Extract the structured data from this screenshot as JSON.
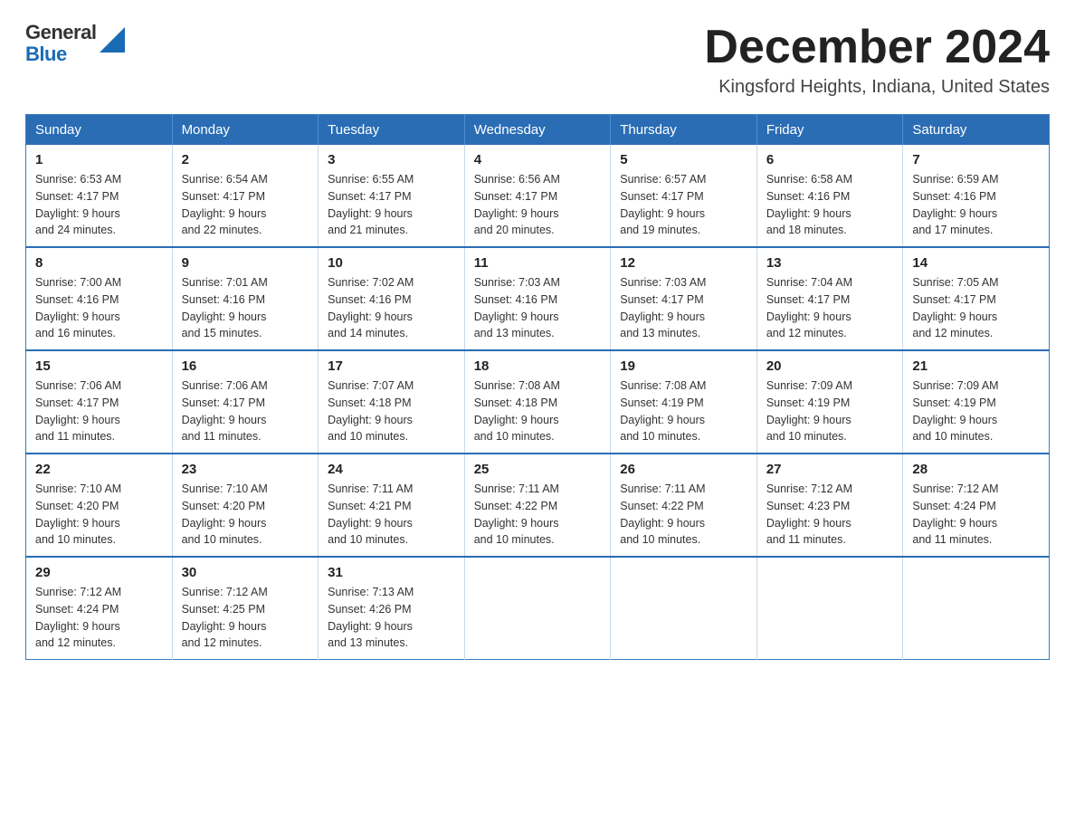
{
  "header": {
    "logo_general": "General",
    "logo_blue": "Blue",
    "month_title": "December 2024",
    "location": "Kingsford Heights, Indiana, United States"
  },
  "days_of_week": [
    "Sunday",
    "Monday",
    "Tuesday",
    "Wednesday",
    "Thursday",
    "Friday",
    "Saturday"
  ],
  "weeks": [
    [
      {
        "day": "1",
        "sunrise": "6:53 AM",
        "sunset": "4:17 PM",
        "daylight": "9 hours and 24 minutes."
      },
      {
        "day": "2",
        "sunrise": "6:54 AM",
        "sunset": "4:17 PM",
        "daylight": "9 hours and 22 minutes."
      },
      {
        "day": "3",
        "sunrise": "6:55 AM",
        "sunset": "4:17 PM",
        "daylight": "9 hours and 21 minutes."
      },
      {
        "day": "4",
        "sunrise": "6:56 AM",
        "sunset": "4:17 PM",
        "daylight": "9 hours and 20 minutes."
      },
      {
        "day": "5",
        "sunrise": "6:57 AM",
        "sunset": "4:17 PM",
        "daylight": "9 hours and 19 minutes."
      },
      {
        "day": "6",
        "sunrise": "6:58 AM",
        "sunset": "4:16 PM",
        "daylight": "9 hours and 18 minutes."
      },
      {
        "day": "7",
        "sunrise": "6:59 AM",
        "sunset": "4:16 PM",
        "daylight": "9 hours and 17 minutes."
      }
    ],
    [
      {
        "day": "8",
        "sunrise": "7:00 AM",
        "sunset": "4:16 PM",
        "daylight": "9 hours and 16 minutes."
      },
      {
        "day": "9",
        "sunrise": "7:01 AM",
        "sunset": "4:16 PM",
        "daylight": "9 hours and 15 minutes."
      },
      {
        "day": "10",
        "sunrise": "7:02 AM",
        "sunset": "4:16 PM",
        "daylight": "9 hours and 14 minutes."
      },
      {
        "day": "11",
        "sunrise": "7:03 AM",
        "sunset": "4:16 PM",
        "daylight": "9 hours and 13 minutes."
      },
      {
        "day": "12",
        "sunrise": "7:03 AM",
        "sunset": "4:17 PM",
        "daylight": "9 hours and 13 minutes."
      },
      {
        "day": "13",
        "sunrise": "7:04 AM",
        "sunset": "4:17 PM",
        "daylight": "9 hours and 12 minutes."
      },
      {
        "day": "14",
        "sunrise": "7:05 AM",
        "sunset": "4:17 PM",
        "daylight": "9 hours and 12 minutes."
      }
    ],
    [
      {
        "day": "15",
        "sunrise": "7:06 AM",
        "sunset": "4:17 PM",
        "daylight": "9 hours and 11 minutes."
      },
      {
        "day": "16",
        "sunrise": "7:06 AM",
        "sunset": "4:17 PM",
        "daylight": "9 hours and 11 minutes."
      },
      {
        "day": "17",
        "sunrise": "7:07 AM",
        "sunset": "4:18 PM",
        "daylight": "9 hours and 10 minutes."
      },
      {
        "day": "18",
        "sunrise": "7:08 AM",
        "sunset": "4:18 PM",
        "daylight": "9 hours and 10 minutes."
      },
      {
        "day": "19",
        "sunrise": "7:08 AM",
        "sunset": "4:19 PM",
        "daylight": "9 hours and 10 minutes."
      },
      {
        "day": "20",
        "sunrise": "7:09 AM",
        "sunset": "4:19 PM",
        "daylight": "9 hours and 10 minutes."
      },
      {
        "day": "21",
        "sunrise": "7:09 AM",
        "sunset": "4:19 PM",
        "daylight": "9 hours and 10 minutes."
      }
    ],
    [
      {
        "day": "22",
        "sunrise": "7:10 AM",
        "sunset": "4:20 PM",
        "daylight": "9 hours and 10 minutes."
      },
      {
        "day": "23",
        "sunrise": "7:10 AM",
        "sunset": "4:20 PM",
        "daylight": "9 hours and 10 minutes."
      },
      {
        "day": "24",
        "sunrise": "7:11 AM",
        "sunset": "4:21 PM",
        "daylight": "9 hours and 10 minutes."
      },
      {
        "day": "25",
        "sunrise": "7:11 AM",
        "sunset": "4:22 PM",
        "daylight": "9 hours and 10 minutes."
      },
      {
        "day": "26",
        "sunrise": "7:11 AM",
        "sunset": "4:22 PM",
        "daylight": "9 hours and 10 minutes."
      },
      {
        "day": "27",
        "sunrise": "7:12 AM",
        "sunset": "4:23 PM",
        "daylight": "9 hours and 11 minutes."
      },
      {
        "day": "28",
        "sunrise": "7:12 AM",
        "sunset": "4:24 PM",
        "daylight": "9 hours and 11 minutes."
      }
    ],
    [
      {
        "day": "29",
        "sunrise": "7:12 AM",
        "sunset": "4:24 PM",
        "daylight": "9 hours and 12 minutes."
      },
      {
        "day": "30",
        "sunrise": "7:12 AM",
        "sunset": "4:25 PM",
        "daylight": "9 hours and 12 minutes."
      },
      {
        "day": "31",
        "sunrise": "7:13 AM",
        "sunset": "4:26 PM",
        "daylight": "9 hours and 13 minutes."
      },
      null,
      null,
      null,
      null
    ]
  ],
  "labels": {
    "sunrise": "Sunrise:",
    "sunset": "Sunset:",
    "daylight": "Daylight:"
  }
}
